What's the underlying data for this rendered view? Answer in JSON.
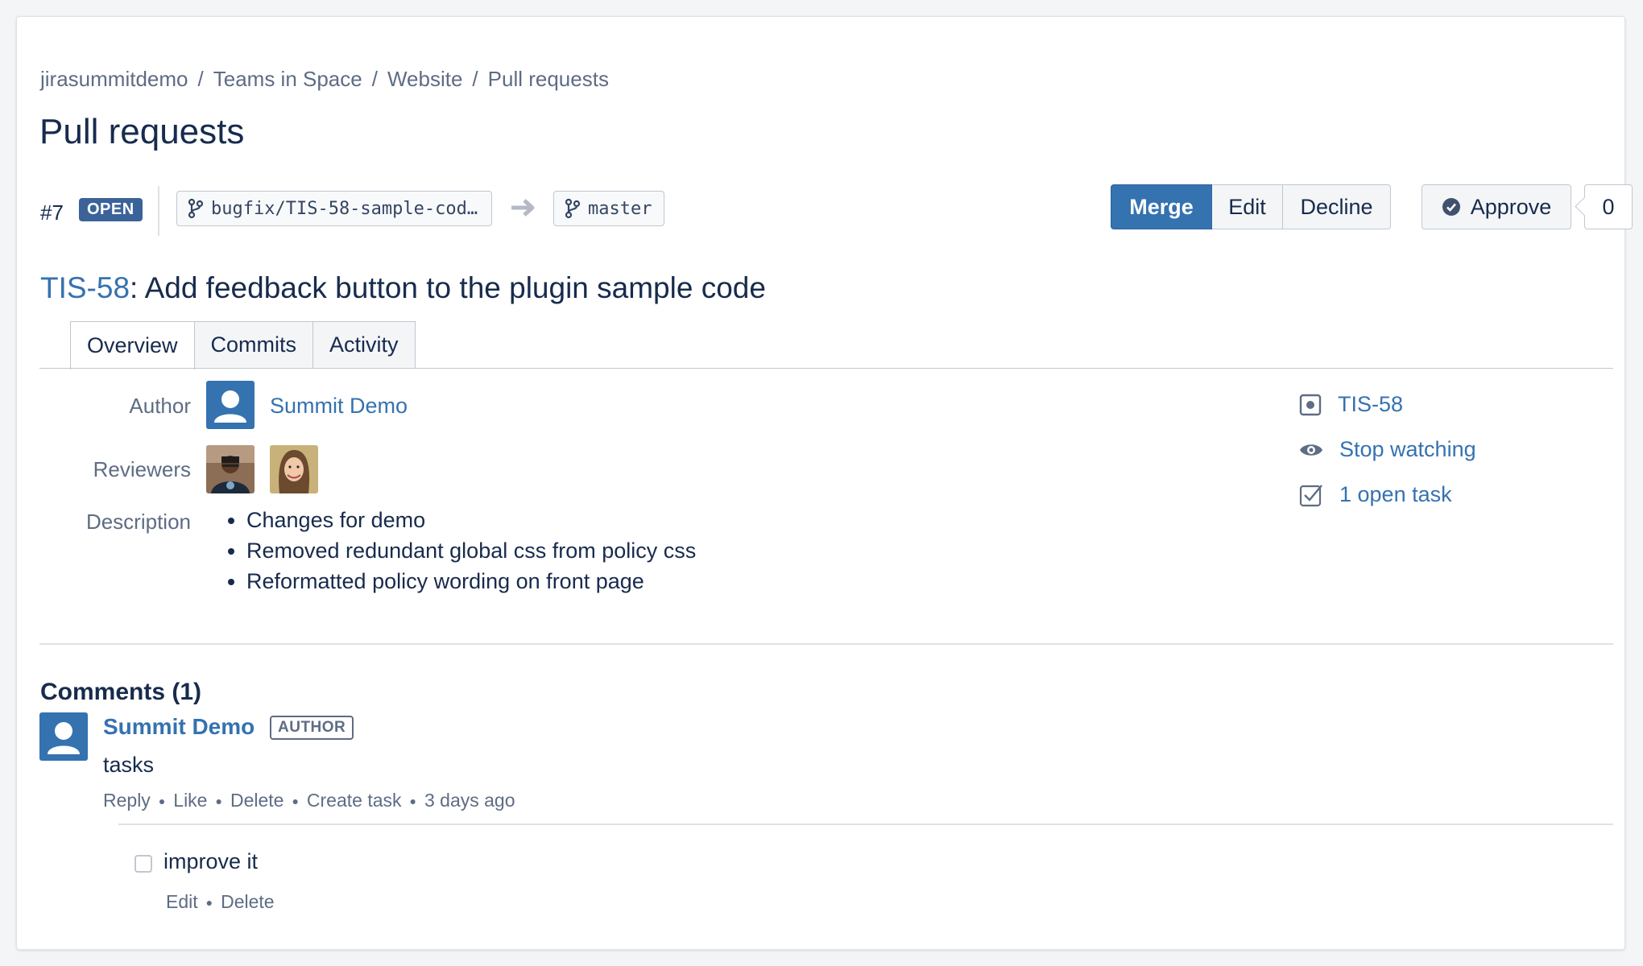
{
  "breadcrumb": {
    "items": [
      "jirasummitdemo",
      "Teams in Space",
      "Website",
      "Pull requests"
    ],
    "separator": "/"
  },
  "page_title": "Pull requests",
  "pr": {
    "number": "#7",
    "state": "OPEN",
    "source_branch": "bugfix/TIS-58-sample-cod…",
    "target_branch": "master",
    "issue_key": "TIS-58",
    "title": ": Add feedback button to the plugin sample code"
  },
  "actions": {
    "merge": "Merge",
    "edit": "Edit",
    "decline": "Decline",
    "approve": "Approve",
    "approve_count": "0"
  },
  "tabs": [
    "Overview",
    "Commits",
    "Activity"
  ],
  "overview": {
    "author_label": "Author",
    "author_name": "Summit Demo",
    "reviewers_label": "Reviewers",
    "description_label": "Description",
    "description_items": [
      "Changes for demo",
      "Removed redundant global css from policy css",
      "Reformatted policy wording on front page"
    ]
  },
  "sidebar": {
    "jira_issue": "TIS-58",
    "watch": "Stop watching",
    "tasks": "1 open task"
  },
  "comments": {
    "heading": "Comments (1)",
    "items": [
      {
        "author": "Summit Demo",
        "badge": "AUTHOR",
        "text": "tasks",
        "actions": [
          "Reply",
          "Like",
          "Delete",
          "Create task"
        ],
        "time": "3 days ago",
        "task": {
          "text": "improve it",
          "actions": [
            "Edit",
            "Delete"
          ]
        }
      }
    ]
  },
  "colors": {
    "link": "#3572b0",
    "lozenge_open": "#3b6399",
    "primary_button": "#3572b0"
  }
}
